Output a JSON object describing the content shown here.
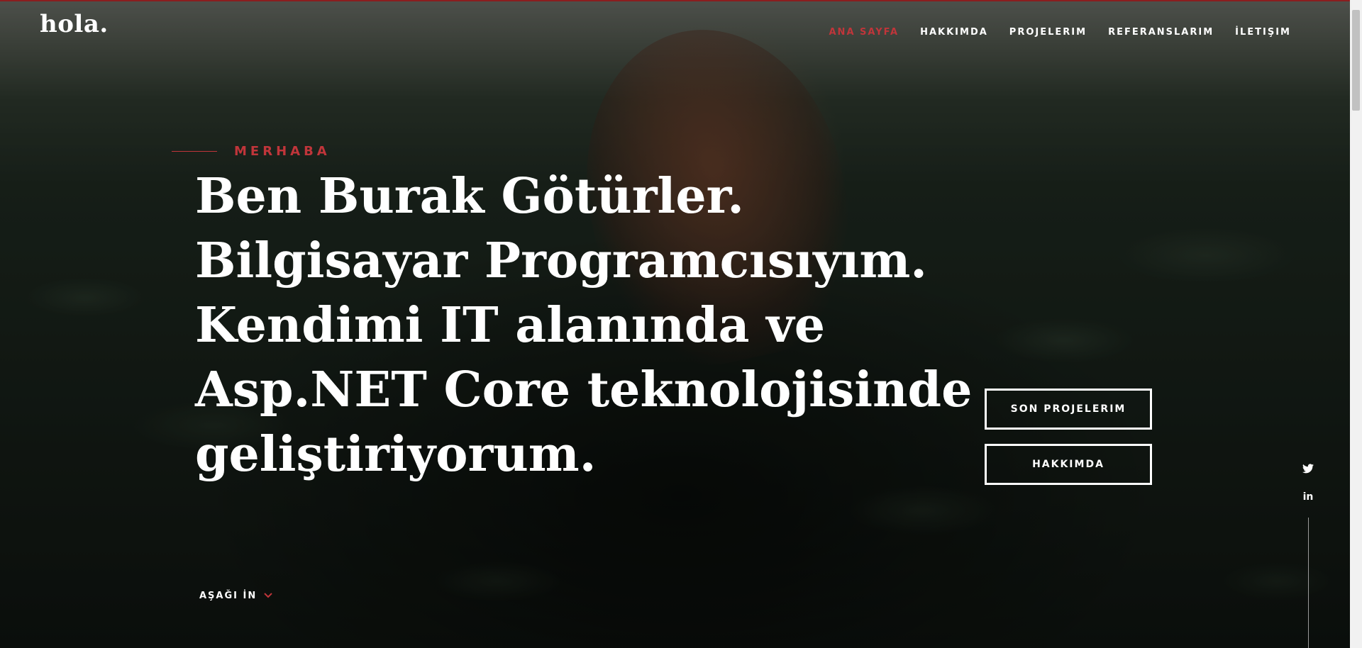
{
  "header": {
    "logo": "hola.",
    "nav": [
      {
        "label": "ANA SAYFA",
        "active": true
      },
      {
        "label": "HAKKIMDA",
        "active": false
      },
      {
        "label": "PROJELERIM",
        "active": false
      },
      {
        "label": "REFERANSLARIM",
        "active": false
      },
      {
        "label": "İLETIŞIM",
        "active": false
      }
    ]
  },
  "hero": {
    "pretitle": "MERHABA",
    "headline_lines": [
      "Ben Burak Götürler.",
      "Bilgisayar Programcısıyım.",
      "Kendimi IT alanında ve",
      "Asp.NET Core teknolojisinde",
      "geliştiriyorum."
    ],
    "buttons": {
      "projects": "SON PROJELERIM",
      "about": "HAKKIMDA"
    },
    "scroll_down": "AŞAĞI İN"
  },
  "social": {
    "icons": [
      "twitter-icon",
      "linkedin-icon"
    ],
    "linkedin_glyph": "in"
  },
  "colors": {
    "accent": "#c0353a",
    "text": "#ffffff"
  }
}
